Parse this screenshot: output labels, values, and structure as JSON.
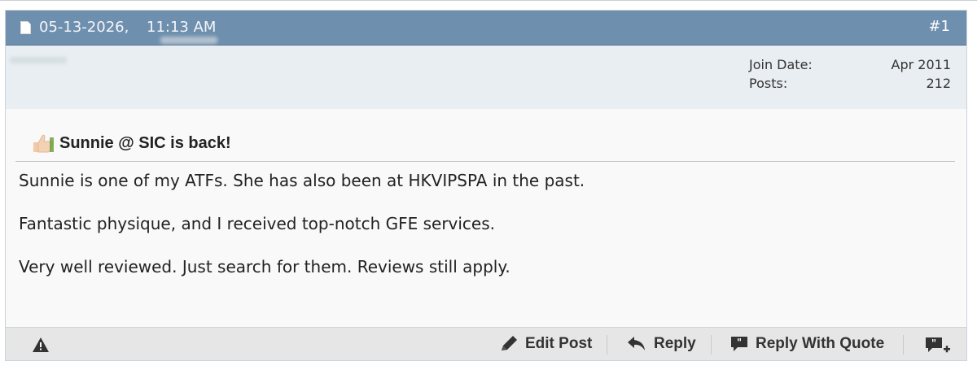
{
  "post": {
    "date": "05-13-2026,",
    "time": "11:13 AM",
    "number": "#1",
    "user": {
      "join_label": "Join Date:",
      "join_value": "Apr 2011",
      "posts_label": "Posts:",
      "posts_value": "212"
    },
    "title": "Sunnie @ SIC is back!",
    "body": [
      "Sunnie is one of my ATFs. She has also been at HKVIPSPA in the past.",
      "Fantastic physique, and I received top-notch GFE services.",
      "Very well reviewed. Just search for them. Reviews still apply."
    ],
    "actions": {
      "edit": "Edit Post",
      "reply": "Reply",
      "reply_quote": "Reply With Quote"
    }
  },
  "colors": {
    "header_bg": "#6f8fae",
    "userinfo_bg": "#e8eef2",
    "footer_bg": "#e6e6e6"
  }
}
